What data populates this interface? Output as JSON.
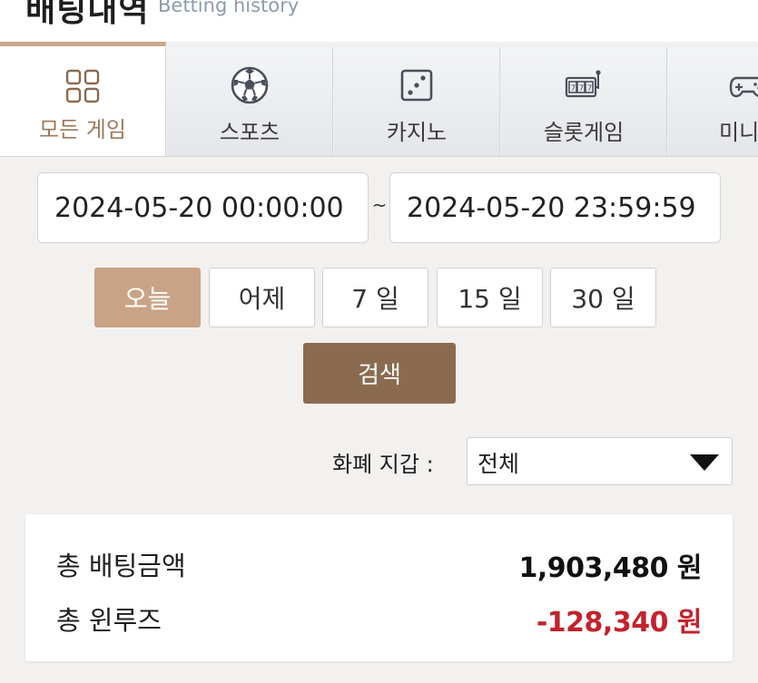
{
  "header": {
    "title": "배팅내역",
    "subtitle": "Betting history"
  },
  "tabs": [
    {
      "label": "모든 게임",
      "icon": "grid-icon",
      "active": true
    },
    {
      "label": "스포츠",
      "icon": "soccer-ball-icon",
      "active": false
    },
    {
      "label": "카지노",
      "icon": "dice-icon",
      "active": false
    },
    {
      "label": "슬롯게임",
      "icon": "slot-machine-icon",
      "active": false
    },
    {
      "label": "미니",
      "icon": "gamepad-icon",
      "active": false
    }
  ],
  "date_range": {
    "start": "2024-05-20 00:00:00",
    "separator": "~",
    "end": "2024-05-20 23:59:59"
  },
  "periods": [
    {
      "label": "오늘",
      "active": true
    },
    {
      "label": "어제",
      "active": false
    },
    {
      "label": "7 일",
      "active": false
    },
    {
      "label": "15 일",
      "active": false
    },
    {
      "label": "30 일",
      "active": false
    }
  ],
  "search_label": "검색",
  "wallet": {
    "label": "화폐 지갑 :",
    "selected": "전체"
  },
  "summary": {
    "total_bet_label": "총 배팅금액",
    "total_bet_value": "1,903,480 원",
    "total_winloss_label": "총 윈루즈",
    "total_winloss_value": "-128,340 원"
  },
  "colors": {
    "accent": "#c9a385",
    "search_button": "#8b6b50",
    "negative": "#c3222c",
    "subtitle": "#8d9bb0"
  }
}
